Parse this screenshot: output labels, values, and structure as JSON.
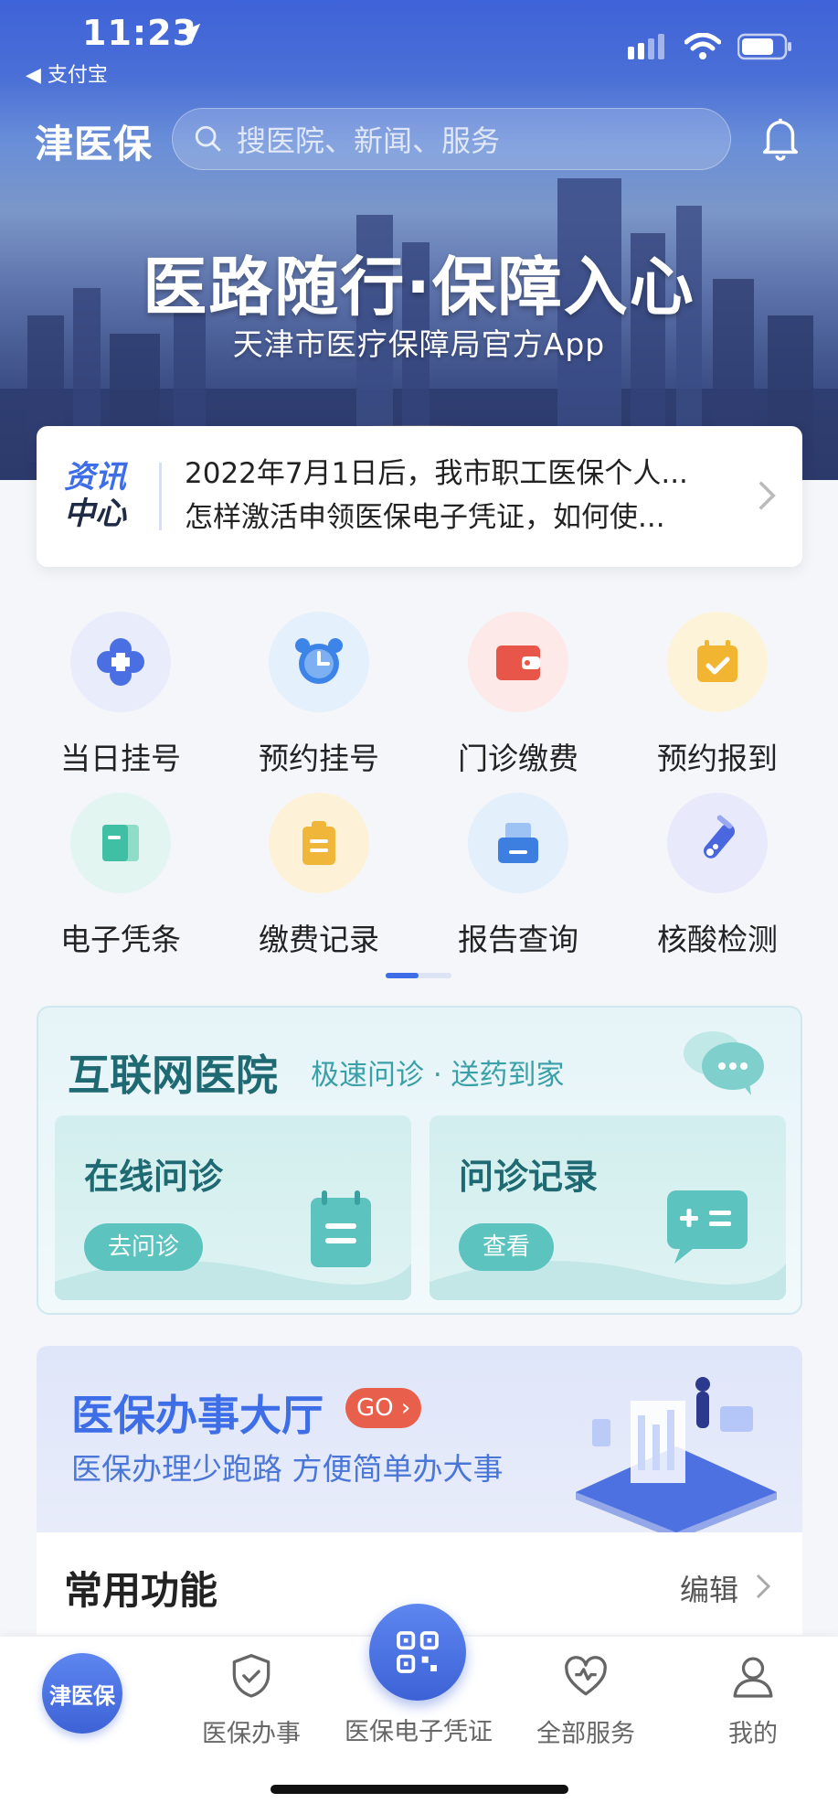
{
  "status_bar": {
    "time": "11:23",
    "back_app": "◀ 支付宝"
  },
  "header": {
    "brand": "津医保",
    "search_placeholder": "搜医院、新闻、服务"
  },
  "banner": {
    "slogan": "医路随行·保障入心",
    "subtitle": "天津市医疗保障局官方App"
  },
  "news": {
    "tag_line1": "资讯",
    "tag_line2": "中心",
    "items": [
      "2022年7月1日后，我市职工医保个人...",
      "怎样激活申领医保电子凭证，如何使..."
    ]
  },
  "services": [
    {
      "label": "当日挂号",
      "icon": "clover-icon",
      "bg": "#e8ecfb",
      "fg": "#4a6fe3"
    },
    {
      "label": "预约挂号",
      "icon": "alarm-clock-icon",
      "bg": "#e4f0fc",
      "fg": "#3d84e8"
    },
    {
      "label": "门诊缴费",
      "icon": "wallet-icon",
      "bg": "#fde9e7",
      "fg": "#e8564a"
    },
    {
      "label": "预约报到",
      "icon": "calendar-check-icon",
      "bg": "#fdf3d9",
      "fg": "#f2b531"
    },
    {
      "label": "电子凭条",
      "icon": "receipt-icon",
      "bg": "#e3f5f1",
      "fg": "#3fbfa3"
    },
    {
      "label": "缴费记录",
      "icon": "clipboard-icon",
      "bg": "#fdf2d8",
      "fg": "#f0b63a"
    },
    {
      "label": "报告查询",
      "icon": "printer-icon",
      "bg": "#e4effc",
      "fg": "#3d7fe0"
    },
    {
      "label": "核酸检测",
      "icon": "test-tube-icon",
      "bg": "#e8eafb",
      "fg": "#4a67e0"
    }
  ],
  "internet_hospital": {
    "title": "互联网医院",
    "subtitle": "极速问诊 · 送药到家",
    "cards": [
      {
        "title": "在线问诊",
        "button": "去问诊",
        "icon": "notepad-icon"
      },
      {
        "title": "问诊记录",
        "button": "查看",
        "icon": "calculator-bubble-icon"
      }
    ]
  },
  "service_hall": {
    "title": "医保办事大厅",
    "go_badge": "GO",
    "subtitle": "医保办理少跑路 方便简单办大事"
  },
  "common_functions": {
    "title": "常用功能",
    "edit": "编辑"
  },
  "tabbar": {
    "home": "津医保",
    "items": [
      "医保办事",
      "医保电子凭证",
      "全部服务",
      "我的"
    ]
  },
  "colors": {
    "accent": "#3d6ee8",
    "teal": "#1f6a72",
    "go_red": "#e8604c"
  }
}
